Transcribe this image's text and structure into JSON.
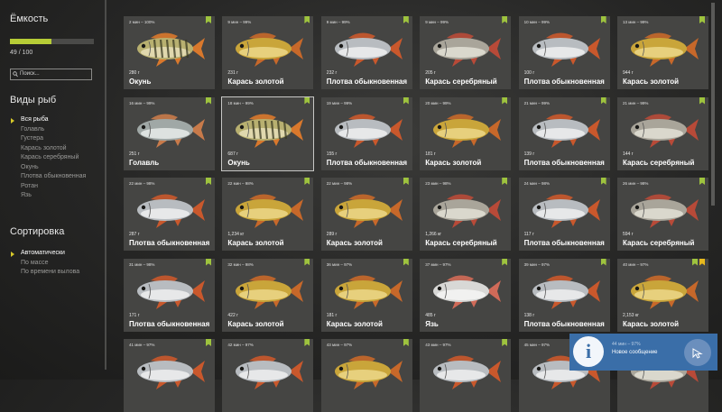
{
  "sidebar": {
    "capacity_title": "Ёмкость",
    "capacity_fraction": 0.49,
    "capacity_text": "49 / 100",
    "search_placeholder": "Поиск...",
    "species_title": "Виды рыб",
    "species": [
      "Вся рыба",
      "Голавль",
      "Густера",
      "Карась золотой",
      "Карась серебряный",
      "Окунь",
      "Плотва обыкновенная",
      "Ротан",
      "Язь"
    ],
    "species_active": 0,
    "sort_title": "Сортировка",
    "sort": [
      "Автоматически",
      "По массе",
      "По времени вылова"
    ],
    "sort_active": 0
  },
  "colors": {
    "accent_green": "#9ec33e",
    "accent_gold": "#e6b81e",
    "notify_blue": "#3a6ea8"
  },
  "cards": [
    {
      "time": "2 мин – 100%",
      "weight": "280 г",
      "name": "Окунь",
      "fish": "perch",
      "badges": [
        "green"
      ]
    },
    {
      "time": "9 мин – 99%",
      "weight": "231 г",
      "name": "Карась золотой",
      "fish": "gold",
      "badges": [
        "green"
      ]
    },
    {
      "time": "9 мин – 99%",
      "weight": "232 г",
      "name": "Плотва обыкновенная",
      "fish": "roach",
      "badges": [
        "green"
      ]
    },
    {
      "time": "9 мин – 99%",
      "weight": "205 г",
      "name": "Карась серебряный",
      "fish": "silver",
      "badges": [
        "green"
      ]
    },
    {
      "time": "10 мин – 99%",
      "weight": "100 г",
      "name": "Плотва обыкновенная",
      "fish": "roach",
      "badges": [
        "green"
      ]
    },
    {
      "time": "13 мин – 99%",
      "weight": "944 г",
      "name": "Карась золотой",
      "fish": "gold",
      "badges": [
        "green"
      ]
    },
    {
      "time": "16 мин – 99%",
      "weight": "251 г",
      "name": "Голавль",
      "fish": "chub",
      "badges": [
        "green"
      ]
    },
    {
      "time": "18 мин – 99%",
      "weight": "687 г",
      "name": "Окунь",
      "fish": "perch",
      "badges": [
        "green"
      ],
      "selected": true
    },
    {
      "time": "19 мин – 99%",
      "weight": "155 г",
      "name": "Плотва обыкновенная",
      "fish": "roach",
      "badges": [
        "green"
      ]
    },
    {
      "time": "20 мин – 99%",
      "weight": "181 г",
      "name": "Карась золотой",
      "fish": "gold",
      "badges": [
        "green"
      ]
    },
    {
      "time": "21 мин – 99%",
      "weight": "139 г",
      "name": "Плотва обыкновенная",
      "fish": "roach",
      "badges": [
        "green"
      ]
    },
    {
      "time": "21 мин – 99%",
      "weight": "144 г",
      "name": "Карась серебряный",
      "fish": "silver",
      "badges": [
        "green"
      ]
    },
    {
      "time": "22 мин – 98%",
      "weight": "287 г",
      "name": "Плотва обыкновенная",
      "fish": "roach",
      "badges": [
        "green"
      ]
    },
    {
      "time": "22 мин – 98%",
      "weight": "1,234 кг",
      "name": "Карась золотой",
      "fish": "gold",
      "badges": [
        "green"
      ]
    },
    {
      "time": "22 мин – 98%",
      "weight": "289 г",
      "name": "Карась золотой",
      "fish": "gold",
      "badges": [
        "green"
      ]
    },
    {
      "time": "23 мин – 98%",
      "weight": "1,266 кг",
      "name": "Карась серебряный",
      "fish": "silver",
      "badges": [
        "green"
      ]
    },
    {
      "time": "24 мин – 98%",
      "weight": "117 г",
      "name": "Плотва обыкновенная",
      "fish": "roach",
      "badges": [
        "green"
      ]
    },
    {
      "time": "26 мин – 98%",
      "weight": "594 г",
      "name": "Карась серебряный",
      "fish": "silver",
      "badges": [
        "green"
      ]
    },
    {
      "time": "31 мин – 98%",
      "weight": "171 г",
      "name": "Плотва обыкновенная",
      "fish": "roach",
      "badges": [
        "green"
      ]
    },
    {
      "time": "32 мин – 98%",
      "weight": "422 г",
      "name": "Карась золотой",
      "fish": "gold",
      "badges": [
        "green"
      ]
    },
    {
      "time": "36 мин – 97%",
      "weight": "181 г",
      "name": "Карась золотой",
      "fish": "gold",
      "badges": [
        "green"
      ]
    },
    {
      "time": "37 мин – 97%",
      "weight": "485 г",
      "name": "Язь",
      "fish": "ide",
      "badges": [
        "green"
      ]
    },
    {
      "time": "39 мин – 97%",
      "weight": "138 г",
      "name": "Плотва обыкновенная",
      "fish": "roach",
      "badges": [
        "green"
      ]
    },
    {
      "time": "40 мин – 97%",
      "weight": "2,153 кг",
      "name": "Карась золотой",
      "fish": "gold",
      "badges": [
        "green",
        "gold"
      ]
    },
    {
      "time": "41 мин – 97%",
      "weight": "",
      "name": "",
      "fish": "roach",
      "badges": [
        "green"
      ]
    },
    {
      "time": "42 мин – 97%",
      "weight": "",
      "name": "",
      "fish": "roach",
      "badges": [
        "green"
      ]
    },
    {
      "time": "43 мин – 97%",
      "weight": "",
      "name": "",
      "fish": "gold",
      "badges": [
        "green"
      ]
    },
    {
      "time": "43 мин – 97%",
      "weight": "",
      "name": "",
      "fish": "roach",
      "badges": [
        "green"
      ]
    },
    {
      "time": "45 мин – 97%",
      "weight": "",
      "name": "",
      "fish": "roach",
      "badges": [
        "green"
      ]
    },
    {
      "time": "",
      "weight": "",
      "name": "",
      "fish": "silver",
      "badges": []
    }
  ],
  "notification": {
    "time": "44 мин – 97%",
    "text": "Новое сообщение"
  }
}
